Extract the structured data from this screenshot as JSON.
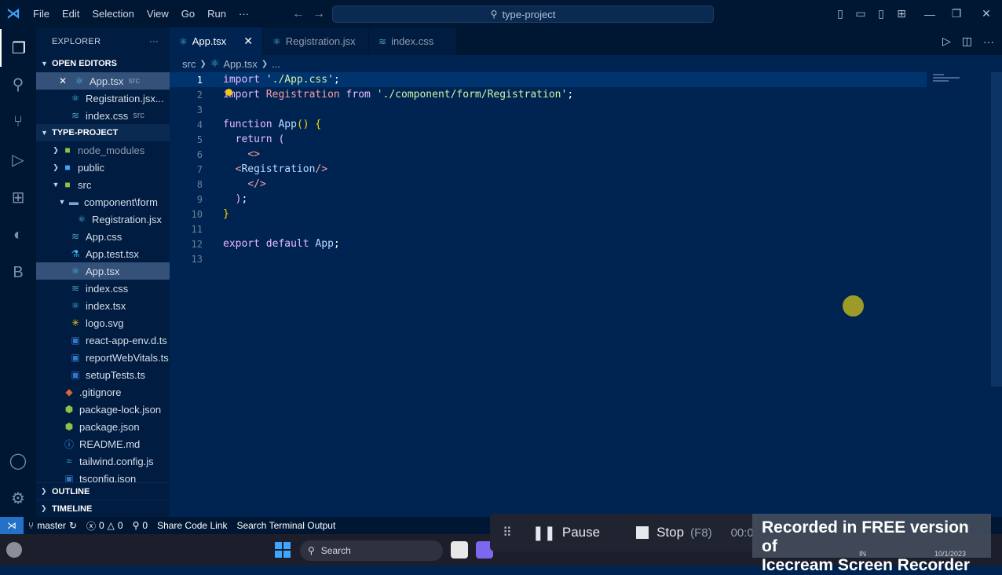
{
  "titlebar": {
    "menu": [
      "File",
      "Edit",
      "Selection",
      "View",
      "Go",
      "Run",
      "···"
    ],
    "command_center": "type-project"
  },
  "sidebar": {
    "title": "EXPLORER",
    "more": "···",
    "open_editors": {
      "label": "OPEN EDITORS",
      "items": [
        {
          "name": "App.tsx",
          "desc": "src"
        },
        {
          "name": "Registration.jsx...",
          "desc": ""
        },
        {
          "name": "index.css",
          "desc": "src"
        }
      ]
    },
    "project": {
      "label": "TYPE-PROJECT",
      "items": [
        {
          "name": "node_modules"
        },
        {
          "name": "public"
        },
        {
          "name": "src"
        },
        {
          "name": "component\\form"
        },
        {
          "name": "Registration.jsx"
        },
        {
          "name": "App.css"
        },
        {
          "name": "App.test.tsx"
        },
        {
          "name": "App.tsx"
        },
        {
          "name": "index.css"
        },
        {
          "name": "index.tsx"
        },
        {
          "name": "logo.svg"
        },
        {
          "name": "react-app-env.d.ts"
        },
        {
          "name": "reportWebVitals.ts"
        },
        {
          "name": "setupTests.ts"
        },
        {
          "name": ".gitignore"
        },
        {
          "name": "package-lock.json"
        },
        {
          "name": "package.json"
        },
        {
          "name": "README.md"
        },
        {
          "name": "tailwind.config.js"
        },
        {
          "name": "tsconfig.json"
        }
      ]
    },
    "outline": "OUTLINE",
    "timeline": "TIMELINE"
  },
  "tabs": [
    {
      "label": "App.tsx"
    },
    {
      "label": "Registration.jsx"
    },
    {
      "label": "index.css"
    }
  ],
  "breadcrumb": {
    "folder": "src",
    "file": "App.tsx",
    "more": "..."
  },
  "editor": {
    "line_numbers": [
      "1",
      "2",
      "3",
      "4",
      "5",
      "6",
      "7",
      "8",
      "9",
      "10",
      "11",
      "12",
      "13"
    ]
  },
  "status": {
    "branch": "master",
    "errors": "0",
    "warnings": "0",
    "ports": "0",
    "share": "Share Code Link",
    "search_output": "Search Terminal Output"
  },
  "taskbar": {
    "search": "Search"
  },
  "recorder": {
    "pause": "Pause",
    "stop": "Stop",
    "stop_key": "(F8)",
    "timer": "00:0",
    "watermark_1": "Recorded in FREE version of",
    "watermark_2": "Icecream Screen Recorder"
  },
  "clock": {
    "date": "10/1/2023",
    "lang": "IN"
  },
  "colors": {
    "accent": "#2472c8",
    "editor_bg": "#002451",
    "sidebar_bg": "#001c40"
  }
}
